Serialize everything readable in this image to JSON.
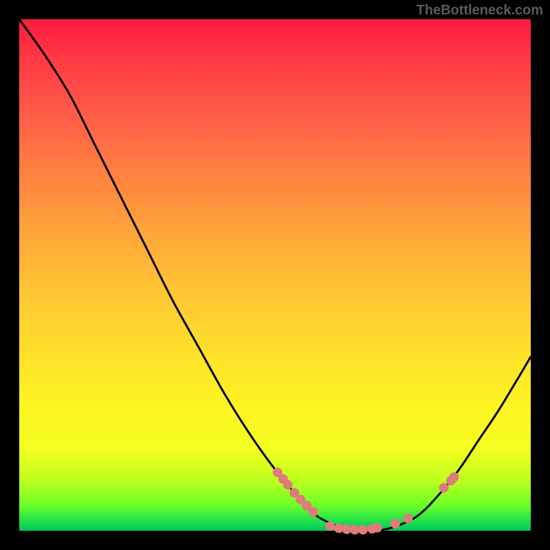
{
  "credit_text": "TheBottleneck.com",
  "colors": {
    "page_bg": "#000000",
    "curve_stroke": "#000000",
    "marker_fill": "#e07b7b",
    "marker_stroke": "#7a3d3d"
  },
  "chart_data": {
    "type": "line",
    "title": "",
    "xlabel": "",
    "ylabel": "",
    "xlim": [
      0,
      1
    ],
    "ylim": [
      0,
      1
    ],
    "grid": false,
    "legend": false,
    "series": [
      {
        "name": "curve",
        "x": [
          0.0,
          0.05,
          0.1,
          0.15,
          0.2,
          0.25,
          0.3,
          0.35,
          0.4,
          0.45,
          0.5,
          0.55,
          0.58,
          0.62,
          0.66,
          0.7,
          0.74,
          0.78,
          0.82,
          0.86,
          0.9,
          0.94,
          1.0
        ],
        "y": [
          1.0,
          0.93,
          0.85,
          0.75,
          0.65,
          0.55,
          0.45,
          0.36,
          0.27,
          0.19,
          0.12,
          0.06,
          0.03,
          0.01,
          0.0,
          0.0,
          0.01,
          0.03,
          0.07,
          0.12,
          0.18,
          0.24,
          0.34
        ]
      }
    ],
    "markers": [
      {
        "x": 0.505,
        "y": 0.114
      },
      {
        "x": 0.516,
        "y": 0.101
      },
      {
        "x": 0.525,
        "y": 0.09
      },
      {
        "x": 0.538,
        "y": 0.074
      },
      {
        "x": 0.55,
        "y": 0.061
      },
      {
        "x": 0.562,
        "y": 0.049
      },
      {
        "x": 0.575,
        "y": 0.037
      },
      {
        "x": 0.608,
        "y": 0.009
      },
      {
        "x": 0.625,
        "y": 0.005
      },
      {
        "x": 0.64,
        "y": 0.003
      },
      {
        "x": 0.656,
        "y": 0.002
      },
      {
        "x": 0.672,
        "y": 0.002
      },
      {
        "x": 0.69,
        "y": 0.004
      },
      {
        "x": 0.7,
        "y": 0.006
      },
      {
        "x": 0.735,
        "y": 0.014
      },
      {
        "x": 0.76,
        "y": 0.024
      },
      {
        "x": 0.83,
        "y": 0.084
      },
      {
        "x": 0.844,
        "y": 0.098
      },
      {
        "x": 0.85,
        "y": 0.105
      }
    ]
  }
}
